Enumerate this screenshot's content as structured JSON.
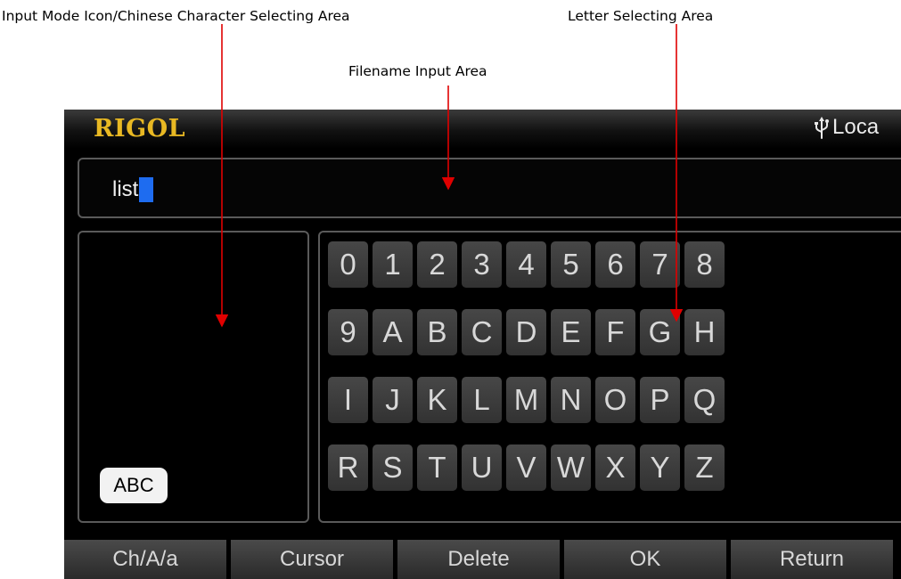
{
  "annotations": {
    "mode_area": "Input Mode Icon/Chinese Character Selecting Area",
    "letter_area": "Letter Selecting Area",
    "filename_area": "Filename Input Area"
  },
  "header": {
    "logo": "RIGOL",
    "status": "Loca",
    "status_icon": "usb-icon"
  },
  "filename_input": {
    "value": "list"
  },
  "input_mode": {
    "label": "ABC"
  },
  "keypad": {
    "rows": [
      [
        "0",
        "1",
        "2",
        "3",
        "4",
        "5",
        "6",
        "7",
        "8"
      ],
      [
        "9",
        "A",
        "B",
        "C",
        "D",
        "E",
        "F",
        "G",
        "H"
      ],
      [
        "I",
        "J",
        "K",
        "L",
        "M",
        "N",
        "O",
        "P",
        "Q"
      ],
      [
        "R",
        "S",
        "T",
        "U",
        "V",
        "W",
        "X",
        "Y",
        "Z"
      ]
    ]
  },
  "softkeys": [
    "Ch/A/a",
    "Cursor",
    "Delete",
    "OK",
    "Return"
  ],
  "colors": {
    "logo": "#e8b823",
    "cursor": "#1e6cf0",
    "annotation_arrow": "#e00000"
  }
}
